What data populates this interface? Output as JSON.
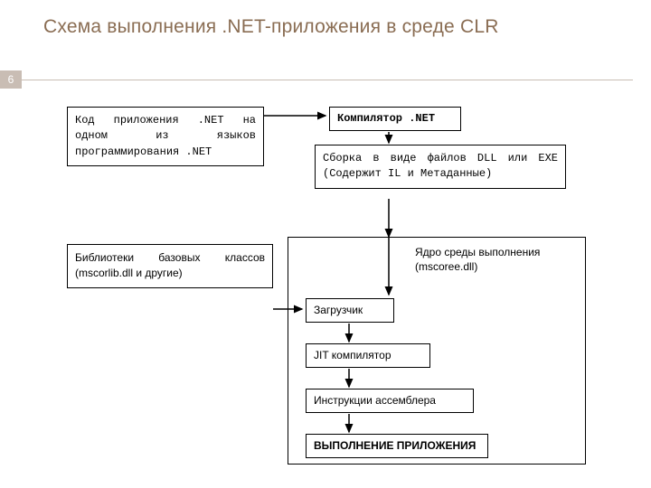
{
  "page": {
    "title": "Схема выполнения .NET-приложения в среде CLR",
    "page_number": "6"
  },
  "boxes": {
    "source": "Код приложения .NET на одном из языков программирования .NET",
    "compiler": "Компилятор .NET",
    "assembly": "Сборка в виде файлов DLL или EXE (Содержит IL и Метаданные)",
    "bcl": "Библиотеки базовых классов (mscorlib.dll и другие)",
    "core": "Ядро среды выполнения (mscoree.dll)",
    "loader": "Загрузчик",
    "jit": "JIT компилятор",
    "asm": "Инструкции ассемблера",
    "exec": "ВЫПОЛНЕНИЕ ПРИЛОЖЕНИЯ"
  }
}
